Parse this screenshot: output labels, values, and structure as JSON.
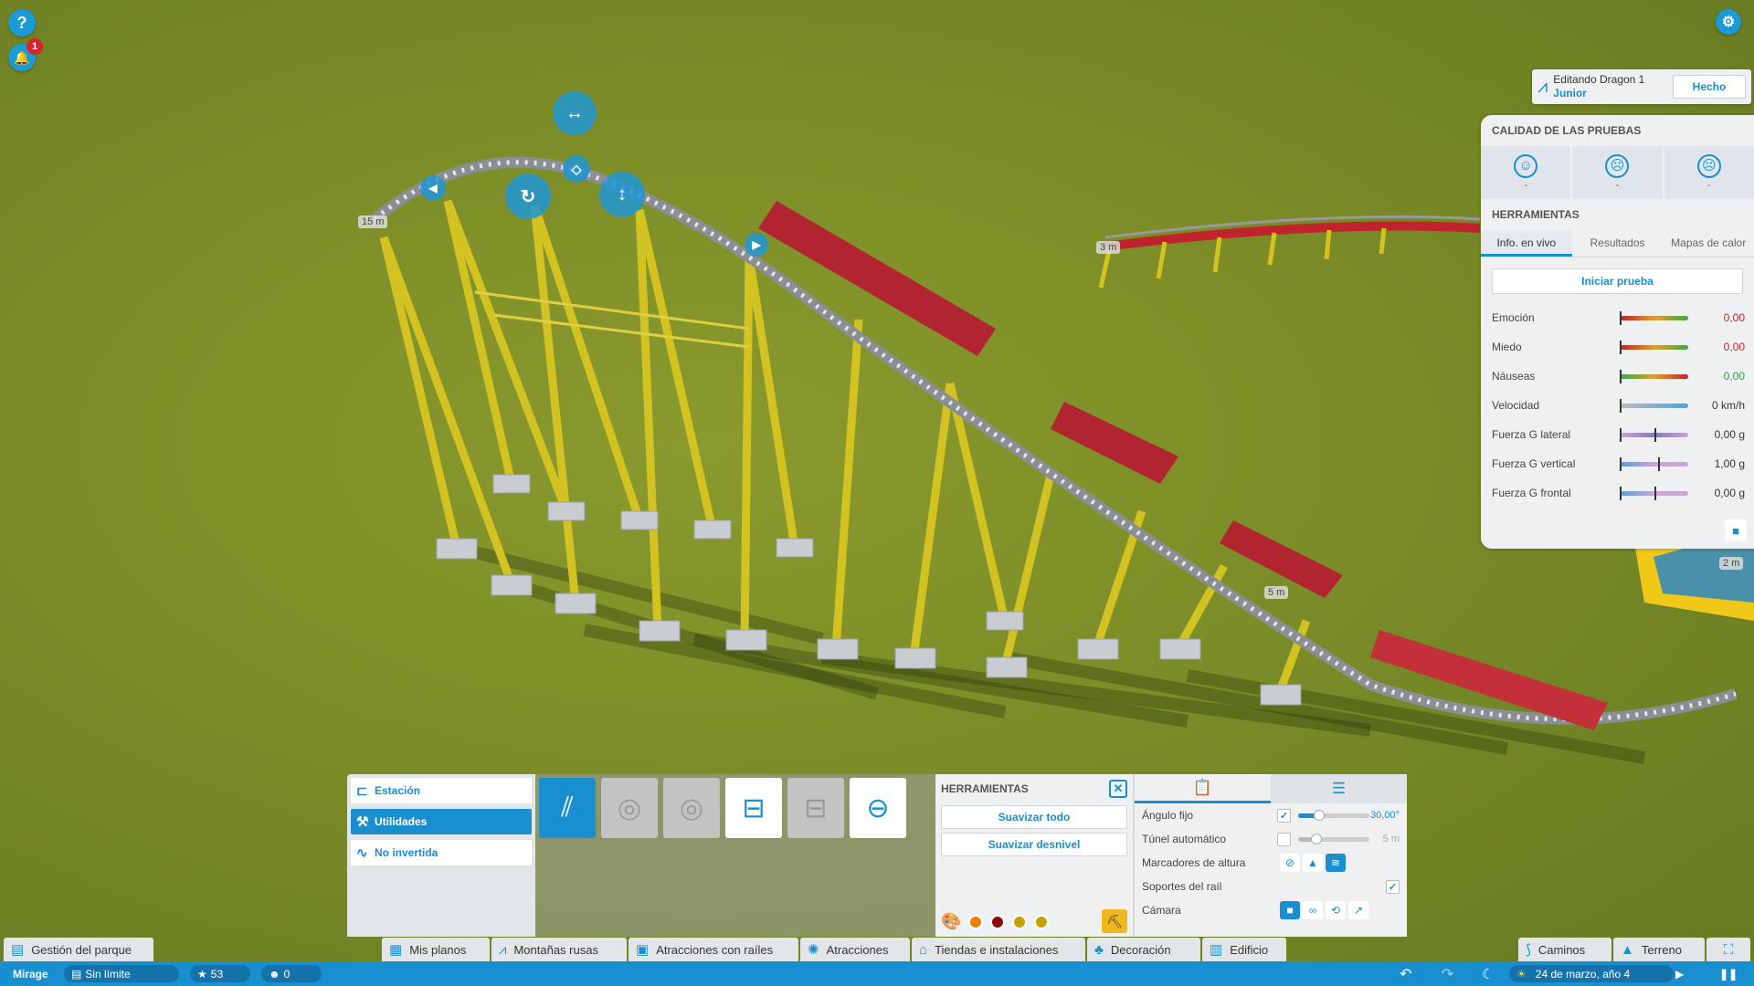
{
  "header": {
    "editing": "Editando Dragon 1",
    "ride_type": "Junior",
    "done": "Hecho"
  },
  "test_panel": {
    "quality_title": "CALIDAD DE LAS PRUEBAS",
    "quality": [
      {
        "icon": "happy-face-icon",
        "value": "-"
      },
      {
        "icon": "sad-face-icon",
        "value": "-"
      },
      {
        "icon": "sick-face-icon",
        "value": "-"
      }
    ],
    "tools_title": "HERRAMIENTAS",
    "tabs": [
      "Info. en vivo",
      "Resultados",
      "Mapas de calor"
    ],
    "start_test": "Iniciar prueba",
    "stats": [
      {
        "label": "Emoción",
        "value": "0,00",
        "color": "#c0232b"
      },
      {
        "label": "Miedo",
        "value": "0,00",
        "color": "#c0232b"
      },
      {
        "label": "Náuseas",
        "value": "0,00",
        "color": "#2e9e3a"
      },
      {
        "label": "Velocidad",
        "value": "0 km/h",
        "color": "#333333"
      },
      {
        "label": "Fuerza G lateral",
        "value": "0,00 g",
        "color": "#333333"
      },
      {
        "label": "Fuerza G vertical",
        "value": "1,00 g",
        "color": "#333333"
      },
      {
        "label": "Fuerza G frontal",
        "value": "0,00 g",
        "color": "#333333"
      }
    ]
  },
  "mode_menu": [
    {
      "label": "Estación",
      "icon": "station-icon",
      "active": false
    },
    {
      "label": "Utilidades",
      "icon": "utilities-icon",
      "active": true
    },
    {
      "label": "No invertida",
      "icon": "non-inverted-icon",
      "active": false
    }
  ],
  "tools_panel": {
    "title": "HERRAMIENTAS",
    "smooth_all": "Suavizar todo",
    "smooth_slope": "Suavizar desnivel",
    "swatches": [
      "#ef7d00",
      "#8a0c12",
      "#c9a100",
      "#c9a100"
    ]
  },
  "options": {
    "fixed_angle": {
      "label": "Ángulo fijo",
      "value": "30,00°",
      "checked": true,
      "level": 0.3
    },
    "auto_tunnel": {
      "label": "Túnel automático",
      "value": "5 m",
      "checked": false,
      "level": 0.25
    },
    "height_markers": {
      "label": "Marcadores de altura"
    },
    "rail_supports": {
      "label": "Soportes del raíl",
      "checked": true
    },
    "camera": {
      "label": "Cámara"
    }
  },
  "height_markers": [
    "15 m",
    "3 m",
    "5 m",
    "2 m"
  ],
  "nav": {
    "park_management": "Gestión del parque",
    "items": [
      "Mis planos",
      "Montañas rusas",
      "Atracciones con raíles",
      "Atracciones",
      "Tiendas e instalaciones",
      "Decoración",
      "Edificio"
    ],
    "paths": "Caminos",
    "terrain": "Terreno"
  },
  "status": {
    "park_name": "Mirage",
    "money": "Sin límite",
    "rating": "53",
    "guests": "0",
    "date": "24 de marzo, año 4"
  },
  "notifications": {
    "count": "1"
  },
  "colors": {
    "accent": "#1a8fd0",
    "grass": "#7d8e28",
    "track_red": "#c0232b",
    "support_yellow": "#d2c222"
  }
}
